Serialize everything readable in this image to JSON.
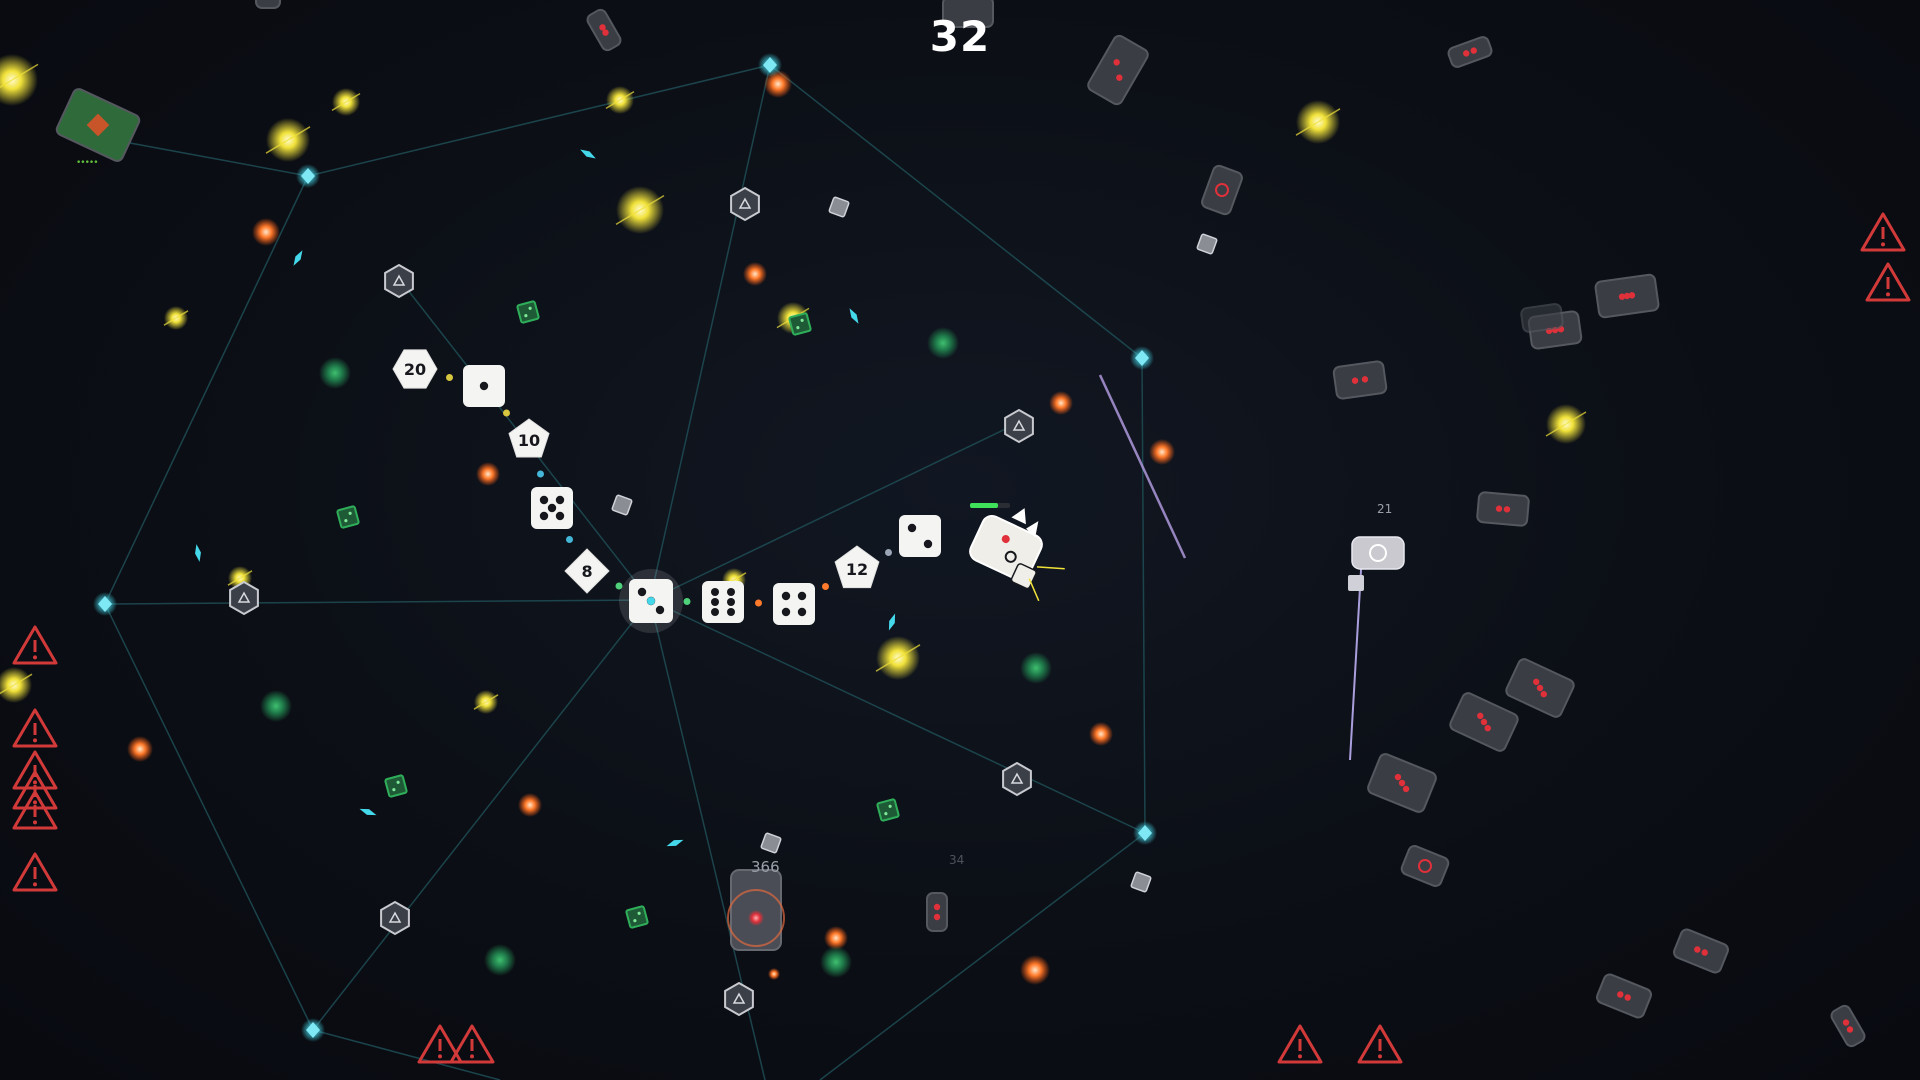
{
  "hud": {
    "score": "32"
  },
  "labels": {
    "enemy_hp_large": "366",
    "enemy_hp_small": "21",
    "faint_number": "34",
    "green_card_dots": "•••••"
  },
  "dice_chain": [
    {
      "kind": "d20",
      "label": "20"
    },
    {
      "kind": "d6",
      "pips": 1
    },
    {
      "kind": "d10",
      "label": "10"
    },
    {
      "kind": "d6",
      "pips": 5
    },
    {
      "kind": "d8",
      "label": "8"
    },
    {
      "kind": "d6",
      "pips": 3,
      "core": true
    },
    {
      "kind": "d6",
      "pips": 6
    },
    {
      "kind": "d6",
      "pips": 4
    },
    {
      "kind": "d12",
      "label": "12"
    },
    {
      "kind": "d6",
      "pips": 2
    }
  ],
  "colors": {
    "background": "#0b0e14",
    "web_line": "#1f4d55",
    "node": "#44d8ea",
    "warning": "#d23a3a",
    "yellow_bug": "#f1e23a",
    "orange_fireball": "#ff7a2a",
    "green_orb": "#1f7a4a",
    "enemy_card": "#3a3d44",
    "enemy_pip": "#e0303a",
    "die_face": "#f4f4f2",
    "green_die": "#2fae5a"
  },
  "icons": {
    "warning": "warning-triangle-icon",
    "node": "crystal-node-icon",
    "turret": "hexagon-turret-icon"
  }
}
